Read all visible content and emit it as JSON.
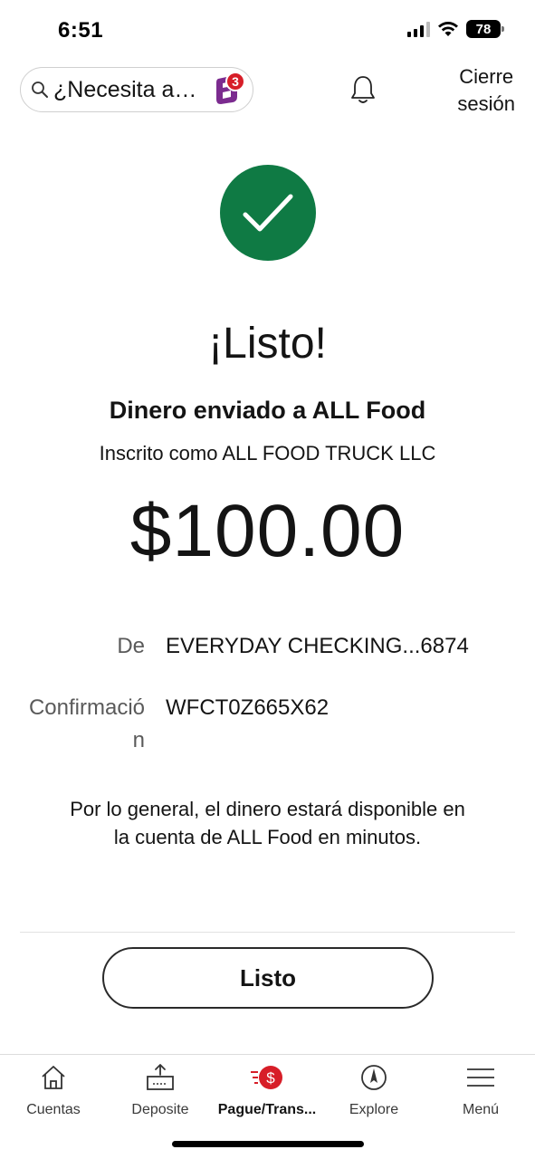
{
  "status_bar": {
    "time": "6:51",
    "battery": "78"
  },
  "header": {
    "search_placeholder": "¿Necesita a…",
    "assistant_badge": "3",
    "signout_line1": "Cierre",
    "signout_line2": "sesión"
  },
  "confirmation": {
    "title": "¡Listo!",
    "subtitle": "Dinero enviado a ALL Food",
    "enrolled_as": "Inscrito como ALL FOOD TRUCK LLC",
    "amount": "$100.00",
    "from_label": "De",
    "from_value": "EVERYDAY CHECKING...6874",
    "confirmation_label": "Confirmación",
    "confirmation_value": "WFCT0Z665X62",
    "note": "Por lo general, el dinero estará disponible en la cuenta de ALL Food en minutos.",
    "done_button": "Listo"
  },
  "tabs": [
    {
      "label": "Cuentas",
      "icon": "home-icon"
    },
    {
      "label": "Deposite",
      "icon": "deposit-icon"
    },
    {
      "label": "Pague/Trans...",
      "icon": "pay-transfer-icon",
      "active": true
    },
    {
      "label": "Explore",
      "icon": "compass-icon"
    },
    {
      "label": "Menú",
      "icon": "menu-icon"
    }
  ],
  "colors": {
    "success_green": "#0f7a44",
    "brand_red": "#d71e28",
    "assistant_purple": "#7b2b8f"
  }
}
